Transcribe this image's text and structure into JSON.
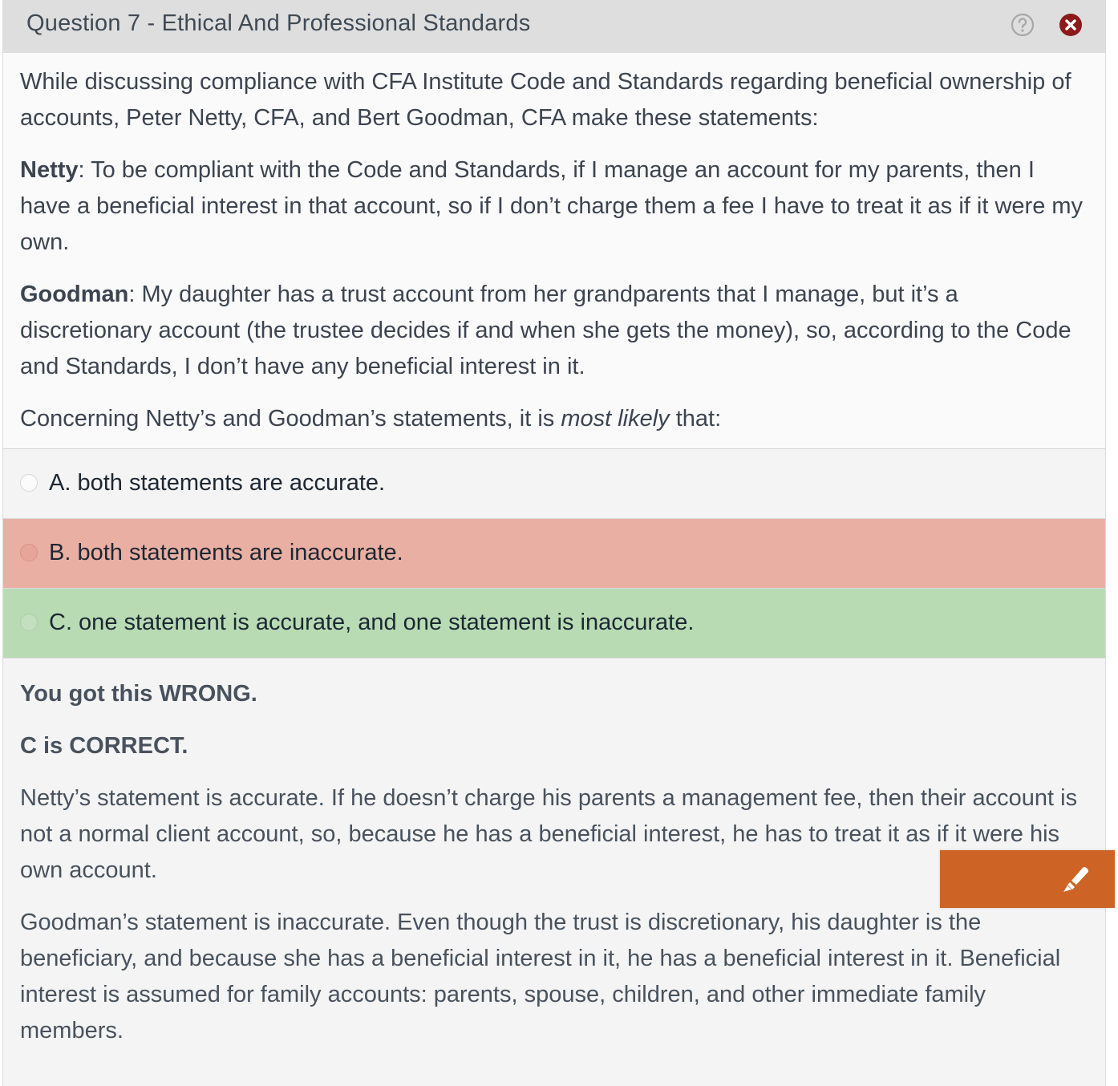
{
  "header": {
    "title": "Question 7 - Ethical And Professional Standards",
    "help_icon": "question-circle-icon",
    "close_icon": "close-circle-icon",
    "close_color": "#8b1a1a"
  },
  "question": {
    "intro": "While discussing compliance with CFA Institute Code and Standards regarding beneficial ownership of accounts, Peter Netty, CFA, and Bert Goodman, CFA make these statements:",
    "statement1_speaker": "Netty",
    "statement1_text": ":  To be compliant with the Code and Standards, if I manage an account for my parents, then I have a beneficial interest in that account, so if I don’t charge them a fee I have to treat it as if it were my own.",
    "statement2_speaker": "Goodman",
    "statement2_text": ":  My daughter has a trust account from her grandparents that I manage, but it’s a discretionary account (the trustee decides if and when she gets the money), so, according to the Code and Standards, I don’t have any beneficial interest in it.",
    "prompt_before": "Concerning Netty’s and Goodman’s statements, it is ",
    "prompt_emphasis": "most likely",
    "prompt_after": " that:"
  },
  "options": [
    {
      "label": "A. both statements are accurate.",
      "state": "unselected"
    },
    {
      "label": "B. both statements are inaccurate.",
      "state": "selected-wrong",
      "color": "#eaafa3"
    },
    {
      "label": "C. one statement is accurate, and one statement is inaccurate.",
      "state": "correct",
      "color": "#b8dbb4"
    }
  ],
  "feedback": {
    "result": "You got this WRONG.",
    "correct_answer": "C is CORRECT.",
    "explanation1": "Netty’s statement is accurate.  If he doesn’t charge his parents a management fee, then their account is not a normal client account, so, because he has a beneficial interest, he has to treat it as if it were his own account.",
    "explanation2": "Goodman’s statement is inaccurate.  Even though the trust is discretionary, his daughter is the beneficiary, and because she has a beneficial interest in it, he has a beneficial interest in it.  Beneficial interest is assumed for family accounts:  parents, spouse, children, and other immediate family members."
  },
  "highlighter": {
    "icon": "highlighter-pen-icon",
    "color": "#cd6426"
  }
}
